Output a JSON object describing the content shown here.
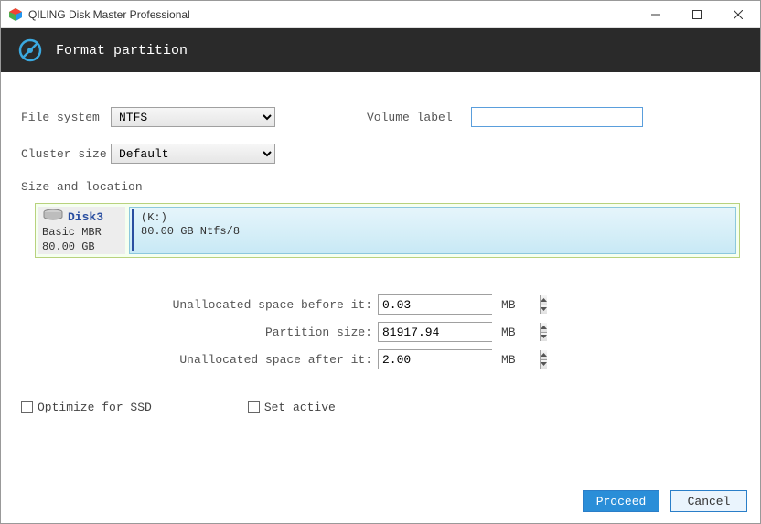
{
  "titlebar": {
    "app_title": "QILING Disk Master Professional"
  },
  "header": {
    "title": "Format partition"
  },
  "filesystem": {
    "label": "File system",
    "value": "NTFS"
  },
  "cluster": {
    "label": "Cluster size",
    "value": "Default"
  },
  "volume_label": {
    "label": "Volume label",
    "value": ""
  },
  "size_section_label": "Size and location",
  "disk": {
    "name": "Disk3",
    "type_line": "Basic MBR",
    "size_line": "80.00 GB",
    "partition": {
      "drive": "(K:)",
      "desc": "80.00 GB Ntfs/8"
    }
  },
  "size_inputs": {
    "before": {
      "label": "Unallocated space before it:",
      "value": "0.03",
      "unit": "MB"
    },
    "partition": {
      "label": "Partition size:",
      "value": "81917.94",
      "unit": "MB"
    },
    "after": {
      "label": "Unallocated space after it:",
      "value": "2.00",
      "unit": "MB"
    }
  },
  "checkboxes": {
    "ssd": "Optimize for SSD",
    "active": "Set active"
  },
  "buttons": {
    "proceed": "Proceed",
    "cancel": "Cancel"
  }
}
